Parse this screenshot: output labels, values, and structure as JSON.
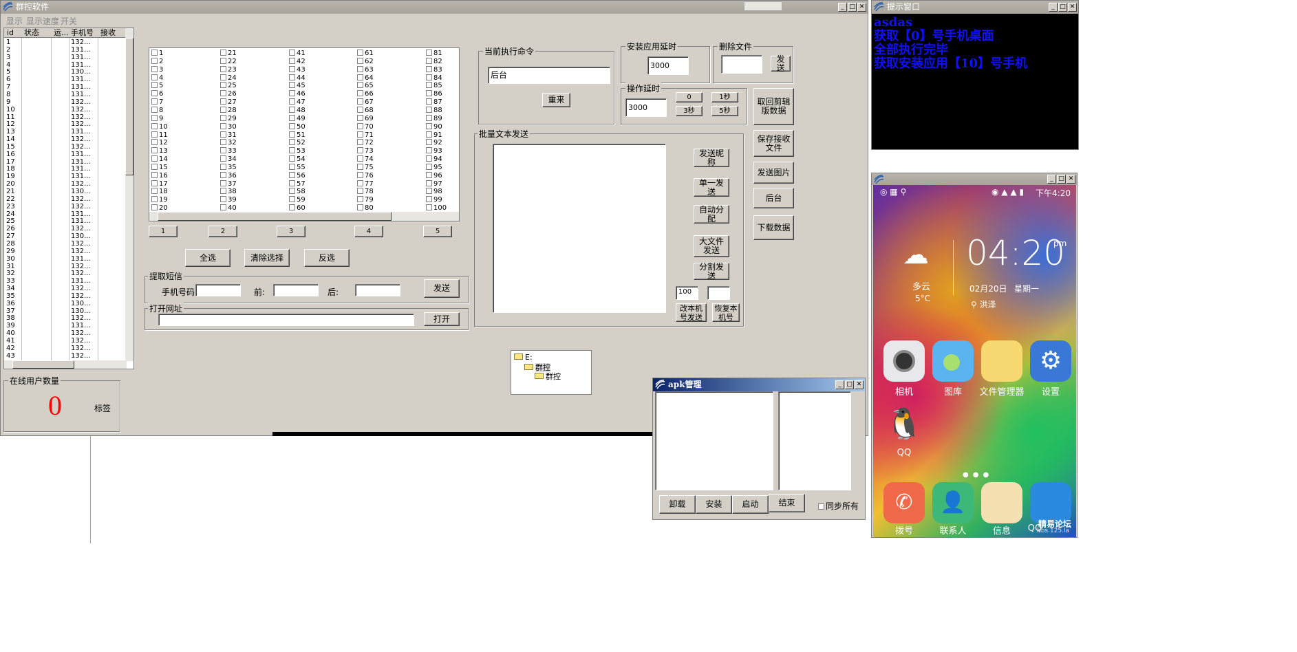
{
  "main": {
    "title": "群控软件",
    "menu": [
      "显示",
      "显示速度",
      "开关"
    ],
    "list": {
      "headers": [
        "id",
        "状态",
        "运...",
        "手机号",
        "接收"
      ],
      "rows": [
        [
          "1",
          "132..."
        ],
        [
          "2",
          "131..."
        ],
        [
          "3",
          "131..."
        ],
        [
          "4",
          "131..."
        ],
        [
          "5",
          "130..."
        ],
        [
          "6",
          "131..."
        ],
        [
          "7",
          "131..."
        ],
        [
          "8",
          "131..."
        ],
        [
          "9",
          "132..."
        ],
        [
          "10",
          "132..."
        ],
        [
          "11",
          "132..."
        ],
        [
          "12",
          "132..."
        ],
        [
          "13",
          "131..."
        ],
        [
          "14",
          "132..."
        ],
        [
          "15",
          "132..."
        ],
        [
          "16",
          "131..."
        ],
        [
          "17",
          "131..."
        ],
        [
          "18",
          "131..."
        ],
        [
          "19",
          "131..."
        ],
        [
          "20",
          "132..."
        ],
        [
          "21",
          "130..."
        ],
        [
          "22",
          "132..."
        ],
        [
          "23",
          "132..."
        ],
        [
          "24",
          "131..."
        ],
        [
          "25",
          "131..."
        ],
        [
          "26",
          "132..."
        ],
        [
          "27",
          "130..."
        ],
        [
          "28",
          "132..."
        ],
        [
          "29",
          "132..."
        ],
        [
          "30",
          "131..."
        ],
        [
          "31",
          "132..."
        ],
        [
          "32",
          "132..."
        ],
        [
          "33",
          "131..."
        ],
        [
          "34",
          "132..."
        ],
        [
          "35",
          "132..."
        ],
        [
          "36",
          "130..."
        ],
        [
          "37",
          "130..."
        ],
        [
          "38",
          "132..."
        ],
        [
          "39",
          "131..."
        ],
        [
          "40",
          "132..."
        ],
        [
          "41",
          "132..."
        ],
        [
          "42",
          "132..."
        ],
        [
          "43",
          "132..."
        ]
      ]
    },
    "online": {
      "group_label": "在线用户数量",
      "count": "0",
      "tag_label": "标签"
    },
    "checkboxes": {
      "cols": [
        [
          "1",
          "2",
          "3",
          "4",
          "5",
          "6",
          "7",
          "8",
          "9",
          "10",
          "11",
          "12",
          "13",
          "14",
          "15",
          "16",
          "17",
          "18",
          "19",
          "20"
        ],
        [
          "21",
          "22",
          "23",
          "24",
          "25",
          "26",
          "27",
          "28",
          "29",
          "30",
          "31",
          "32",
          "33",
          "34",
          "35",
          "36",
          "37",
          "38",
          "39",
          "40"
        ],
        [
          "41",
          "42",
          "43",
          "44",
          "45",
          "46",
          "47",
          "48",
          "49",
          "50",
          "51",
          "52",
          "53",
          "54",
          "55",
          "56",
          "57",
          "58",
          "59",
          "60"
        ],
        [
          "61",
          "62",
          "63",
          "64",
          "65",
          "66",
          "67",
          "68",
          "69",
          "70",
          "71",
          "72",
          "73",
          "74",
          "75",
          "76",
          "77",
          "78",
          "79",
          "80"
        ],
        [
          "81",
          "82",
          "83",
          "84",
          "85",
          "86",
          "87",
          "88",
          "89",
          "90",
          "91",
          "92",
          "93",
          "94",
          "95",
          "96",
          "97",
          "98",
          "99",
          "100"
        ]
      ],
      "page_buttons": [
        "1",
        "2",
        "3",
        "4",
        "5"
      ],
      "select_all": "全选",
      "clear": "清除选择",
      "invert": "反选"
    },
    "sms": {
      "group_label": "提取短信",
      "phone_label": "手机号码",
      "before_label": "前:",
      "after_label": "后:",
      "send": "发送"
    },
    "url": {
      "group_label": "打开网址",
      "open": "打开",
      "value": ""
    },
    "command": {
      "group_label": "当前执行命令",
      "value": "后台",
      "redo": "重来"
    },
    "install_delay": {
      "group_label": "安装应用延时",
      "value": "3000"
    },
    "delete_file": {
      "group_label": "删除文件",
      "send": "发送"
    },
    "op_delay": {
      "group_label": "操作延时",
      "value": "3000",
      "b0": "0",
      "b1": "1秒",
      "b3": "3秒",
      "b5": "5秒"
    },
    "side_buttons": [
      "取回剪辑版数据",
      "保存接收文件",
      "发送图片",
      "后台",
      "下载数据"
    ],
    "batch": {
      "group_label": "批量文本发送",
      "nick": "发送昵称",
      "single": "单一发送",
      "auto": "自动分配",
      "bigfile": "大文件发送",
      "split": "分割发送",
      "num": "100",
      "change": "改本机号发送",
      "restore": "恢复本机号"
    },
    "tree": [
      "E:",
      "群控",
      "群控"
    ]
  },
  "hint": {
    "title": "提示窗口",
    "lines": [
      "asdas",
      "获取【0】号手机桌面",
      "全部执行完毕",
      "获取安装应用【10】号手机"
    ]
  },
  "apk": {
    "title": "apk管理",
    "uninstall": "卸载",
    "install": "安装",
    "start": "启动",
    "end": "结束",
    "sync": "同步所有"
  },
  "phone": {
    "time_status": "下午4:20",
    "clock": "04:20",
    "ampm": "pm",
    "weather": "多云",
    "temp": "5°C",
    "date": "02月20日",
    "weekday": "星期一",
    "location": "洪泽",
    "apps": [
      "相机",
      "图库",
      "文件管理器",
      "设置",
      "QQ"
    ],
    "dock": [
      "拨号",
      "联系人",
      "信息",
      "QQ"
    ],
    "watermark": "精易论坛",
    "watermark2": "bbs.125.la"
  }
}
